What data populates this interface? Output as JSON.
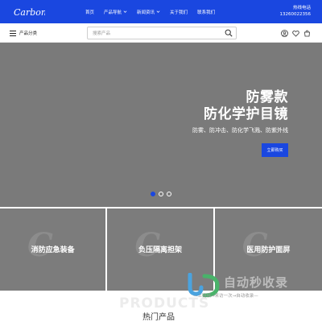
{
  "header": {
    "logo_text": "Carbon",
    "nav": [
      {
        "label": "首页",
        "has_dropdown": false
      },
      {
        "label": "产品导航",
        "has_dropdown": true
      },
      {
        "label": "新闻资讯",
        "has_dropdown": true
      },
      {
        "label": "关于我们",
        "has_dropdown": false
      },
      {
        "label": "联系我们",
        "has_dropdown": false
      }
    ],
    "hotline_label": "热线电话",
    "hotline_number": "13260022356"
  },
  "toolbar": {
    "category_label": "产品分类",
    "search_placeholder": "搜索产品",
    "icons": [
      "user-icon",
      "heart-icon",
      "cart-icon"
    ]
  },
  "hero": {
    "title_line1": "防雾款",
    "title_line2": "防化学护目镜",
    "subtitle": "防雾、防冲击、防化学飞溅、防紫外线",
    "button_label": "立即购买",
    "slide_count": 3,
    "active_slide": 1
  },
  "categories": [
    {
      "label": "消防应急装备"
    },
    {
      "label": "负压隔离担架"
    },
    {
      "label": "医用防护面屏"
    }
  ],
  "section": {
    "ghost_text": "PRODUCTS",
    "title": "热门产品"
  },
  "watermark": {
    "title": "自动秒收录",
    "tagline": "—上链接→来访一次→自动收录—"
  },
  "colors": {
    "brand_blue": "#1a47e0",
    "hero_gray": "#7a7a7a"
  }
}
